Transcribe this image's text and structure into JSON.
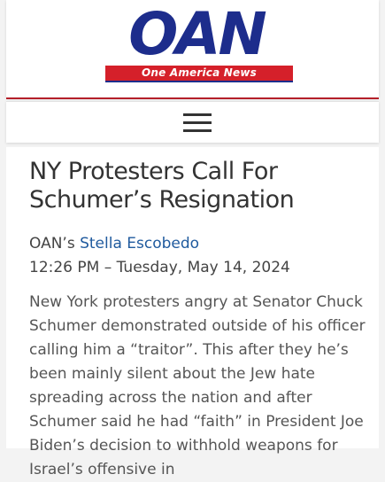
{
  "header": {
    "logo_main": "OAN",
    "logo_tagline": "One America News"
  },
  "nav": {
    "menu_icon": "hamburger-menu-icon"
  },
  "article": {
    "title": "NY Protesters Call For Schumer’s Resignation",
    "byline_prefix": "OAN’s ",
    "author": "Stella Escobedo",
    "timestamp": "12:26 PM – Tuesday, May 14, 2024",
    "body": "New York protesters angry at Senator Chuck Schumer demonstrated outside of his officer calling him a “traitor”. This after they he’s been mainly silent about the Jew hate spreading across the nation and after Schumer said he had “faith” in President Joe Biden’s decision to withhold weapons for Israel’s offensive in"
  },
  "colors": {
    "brand_blue": "#1d2d8c",
    "brand_red": "#d5202a",
    "link": "#1f5a9e"
  }
}
